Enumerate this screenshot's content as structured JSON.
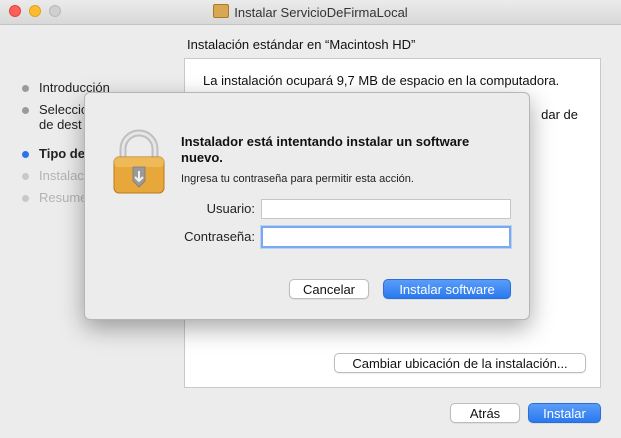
{
  "window": {
    "title": "Instalar ServicioDeFirmaLocal",
    "header": "Instalación estándar en “Macintosh HD”"
  },
  "steps": [
    {
      "label": "Introducción",
      "state": "done"
    },
    {
      "label_line1": "Seleccion",
      "label_line2": "de dest",
      "state": "done"
    },
    {
      "label": "Tipo de",
      "state": "active"
    },
    {
      "label": "Instalac",
      "state": "future"
    },
    {
      "label": "Resume",
      "state": "future"
    }
  ],
  "content": {
    "text": "La instalación ocupará 9,7 MB de espacio en la computadora.",
    "text_partial": "dar de",
    "change_location_button": "Cambiar ubicación de la instalación..."
  },
  "footer": {
    "back_button": "Atrás",
    "install_button": "Instalar"
  },
  "dialog": {
    "title": "Instalador está intentando instalar un software nuevo.",
    "message": "Ingresa tu contraseña para permitir esta acción.",
    "username_label": "Usuario:",
    "username_value": "",
    "password_label": "Contraseña:",
    "password_value": "",
    "cancel_button": "Cancelar",
    "install_software_button": "Instalar software",
    "icon": "lock-icon"
  },
  "colors": {
    "accent": "#2b79ef",
    "close": "#fe5f57",
    "minimize": "#febc2e",
    "lock_body": "#e8a73a"
  }
}
